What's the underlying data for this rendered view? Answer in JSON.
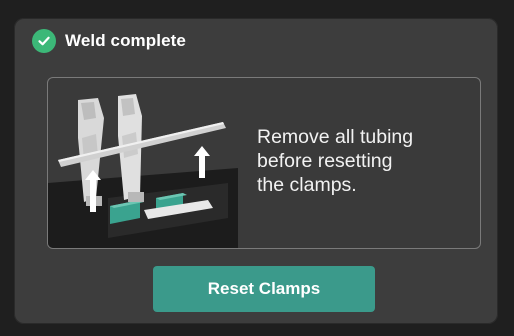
{
  "dialog": {
    "status_icon": "check-circle-icon",
    "title": "Weld complete",
    "colors": {
      "success": "#3cb878",
      "button": "#3b9a8b",
      "background": "#3d3d3d"
    }
  },
  "instruction": {
    "image": "clamp-tubing-removal-illustration",
    "text": "Remove all tubing\nbefore resetting\nthe clamps."
  },
  "actions": {
    "reset_label": "Reset Clamps"
  }
}
